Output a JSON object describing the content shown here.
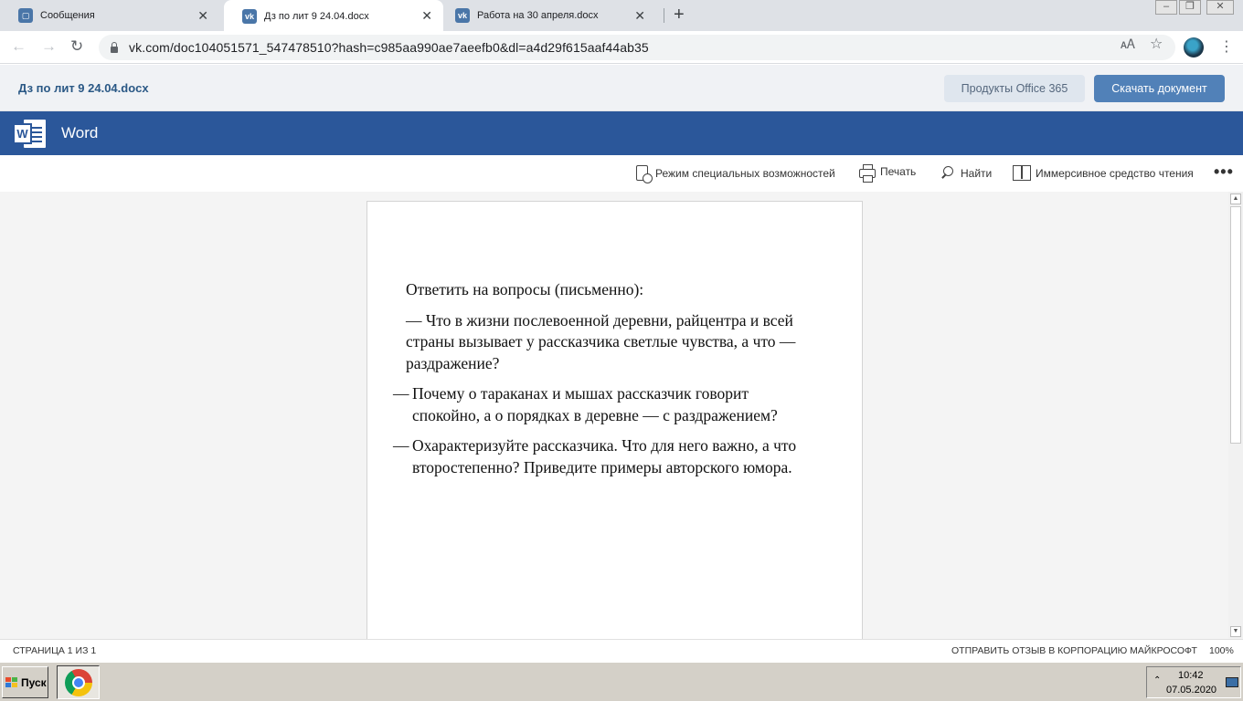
{
  "browser": {
    "tabs": [
      {
        "title": "Сообщения",
        "favicon": "messages-icon",
        "active": false
      },
      {
        "title": "Дз по лит 9 24.04.docx",
        "favicon": "vk-icon",
        "active": true
      },
      {
        "title": "Работа на 30 апреля.docx",
        "favicon": "vk-icon",
        "active": false
      }
    ],
    "url": "vk.com/doc104051571_547478510?hash=c985aa990ae7aeefb0&dl=a4d29f615aaf44ab35"
  },
  "vk_header": {
    "document_name": "Дз по лит 9 24.04.docx",
    "office_button": "Продукты Office 365",
    "download_button": "Скачать документ"
  },
  "word": {
    "app_name": "Word",
    "logo_letter": "W",
    "commands": {
      "accessibility": "Режим специальных возможностей",
      "print": "Печать",
      "find": "Найти",
      "immersive_reader": "Иммерсивное средство чтения",
      "more": "•••"
    }
  },
  "document": {
    "heading": "Ответить на вопросы (письменно):",
    "intro_question": "— Что в жизни послевоенной деревни, райцентра и всей страны вызывает у рассказчика светлые чувства, а что — раздражение?",
    "questions": [
      {
        "dash": "—",
        "text": "Почему о тараканах и мышах рассказчик говорит спокойно, а о порядках в деревне — с раздражением?"
      },
      {
        "dash": "—",
        "text": "Охарактеризуйте рассказчика. Что для него важно, а что второстепенно? Приведите примеры авторского юмора."
      }
    ]
  },
  "status_bar": {
    "page": "СТРАНИЦА 1 ИЗ 1",
    "feedback": "ОТПРАВИТЬ ОТЗЫВ В КОРПОРАЦИЮ МАЙКРОСОФТ",
    "zoom": "100%"
  },
  "taskbar": {
    "start_label": "Пуск",
    "time": "10:42",
    "date": "07.05.2020"
  },
  "colors": {
    "word_blue": "#2b579a",
    "vk_button": "#5181b8",
    "vk_link": "#2a5885"
  }
}
